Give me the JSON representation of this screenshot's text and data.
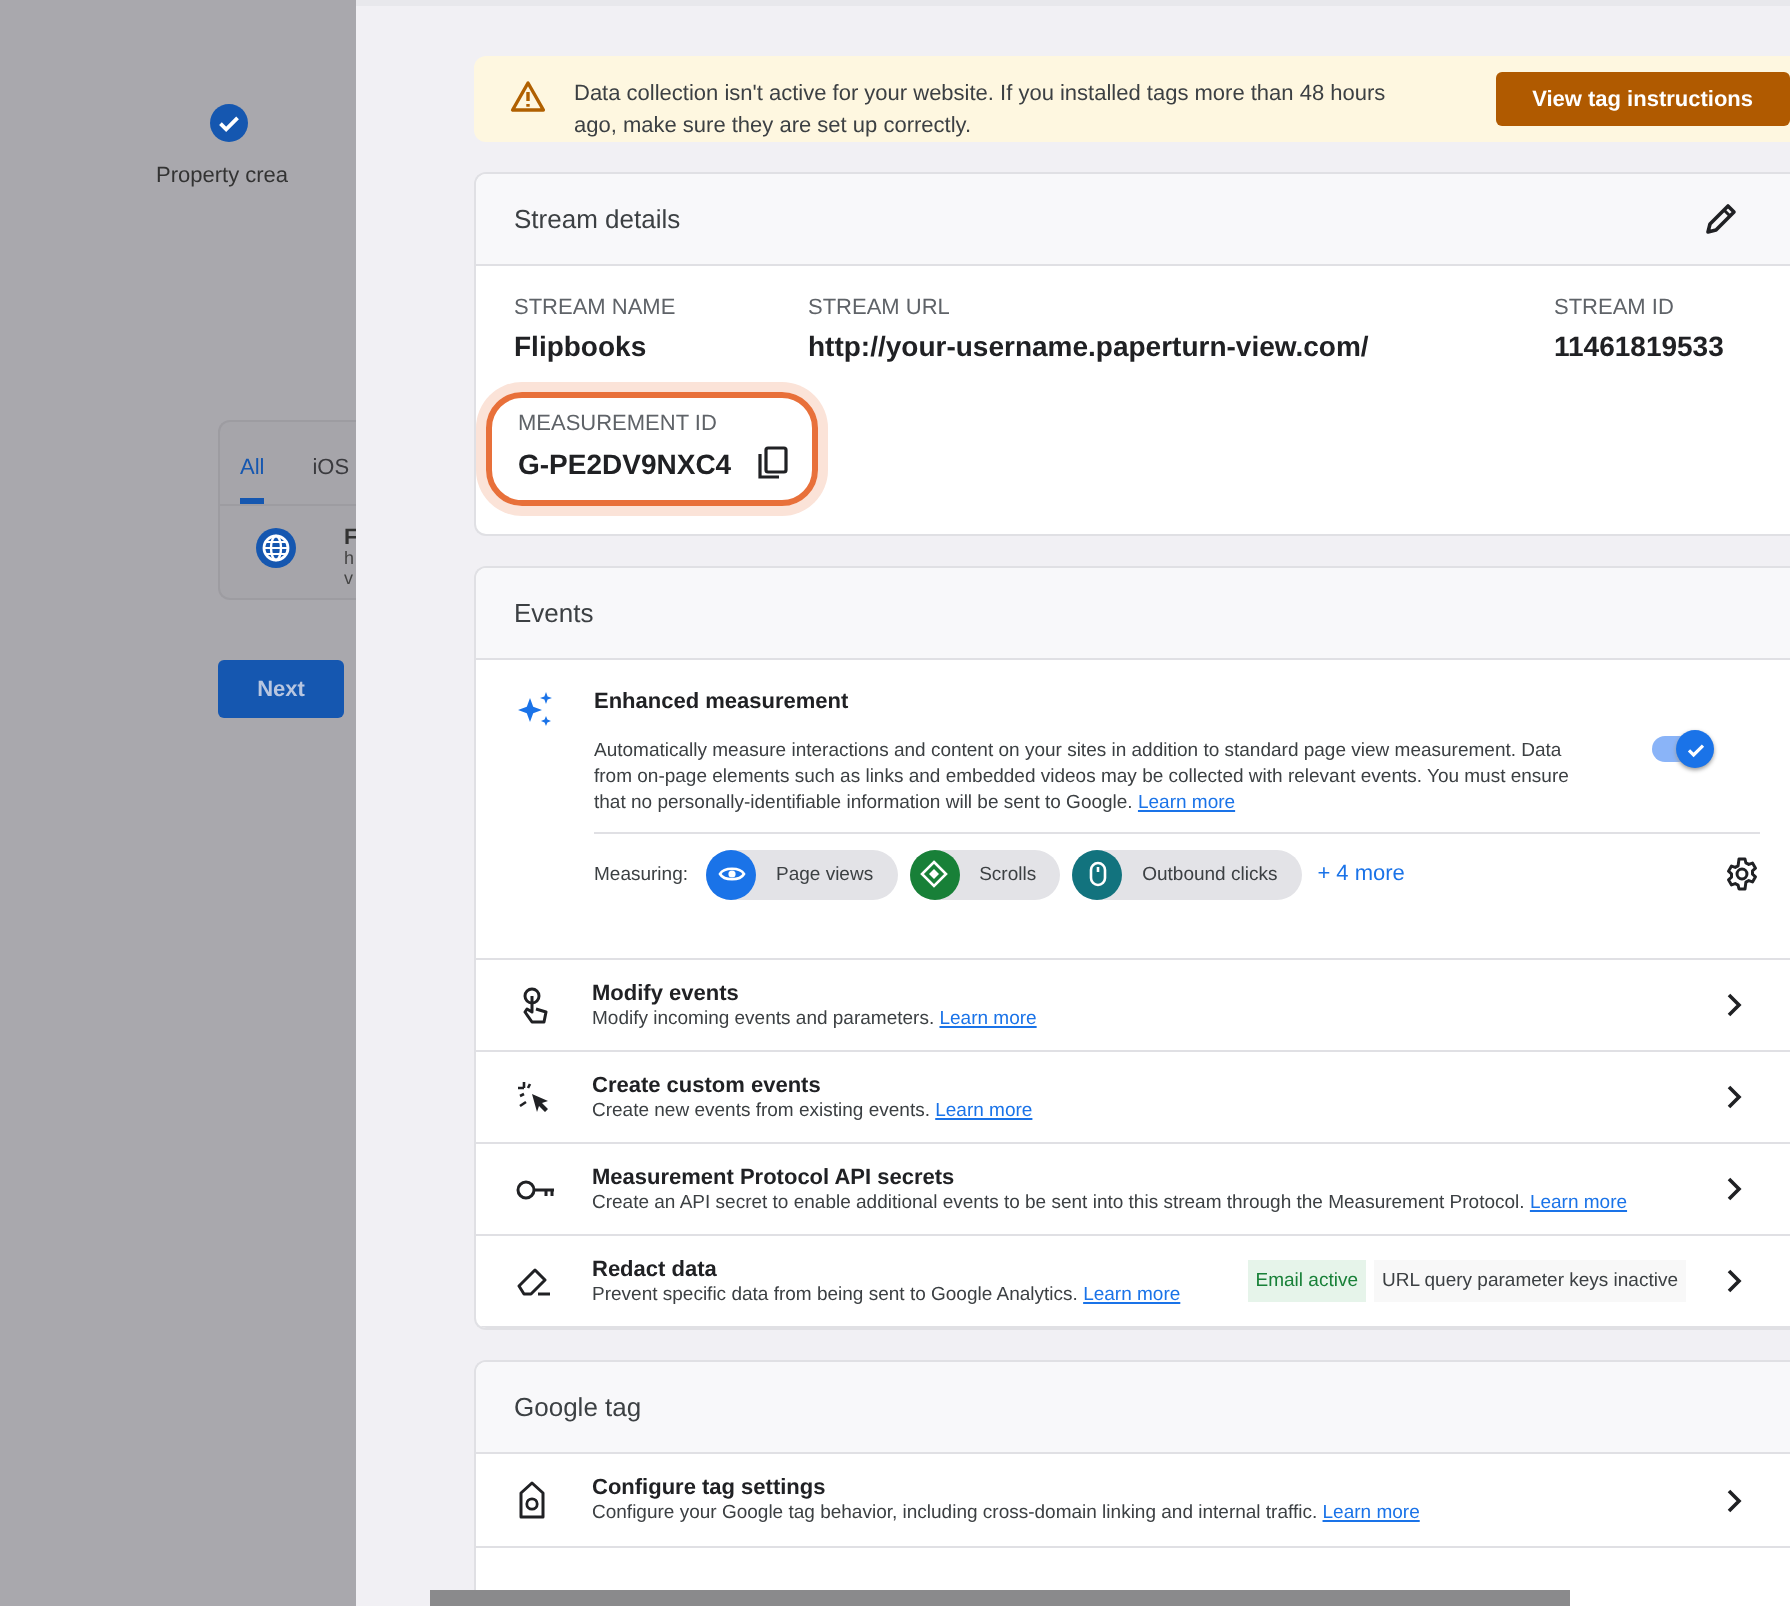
{
  "background_page": {
    "step_label": "Property crea",
    "step_done": true,
    "tabs": [
      {
        "label": "All",
        "selected": true
      },
      {
        "label": "iOS",
        "selected": false
      }
    ],
    "stream_item_lines": [
      "F",
      "h",
      "v"
    ],
    "next_button": "Next"
  },
  "banner": {
    "message": "Data collection isn't active for your website. If you installed tags more than 48 hours ago, make sure they are set up correctly.",
    "button": "View tag instructions"
  },
  "stream_details": {
    "title": "Stream details",
    "fields": [
      {
        "label": "STREAM NAME",
        "value": "Flipbooks"
      },
      {
        "label": "STREAM URL",
        "value": "http://your-username.paperturn-view.com/"
      },
      {
        "label": "STREAM ID",
        "value": "11461819533"
      }
    ],
    "measurement_id": {
      "label": "MEASUREMENT ID",
      "value": "G-PE2DV9NXC4",
      "highlighted": true
    }
  },
  "events": {
    "title": "Events",
    "enhanced": {
      "title": "Enhanced measurement",
      "description": "Automatically measure interactions and content on your sites in addition to standard page view measurement. Data from on-page elements such as links and embedded videos may be collected with relevant events. You must ensure that no personally-identifiable information will be sent to Google.",
      "link": "Learn more",
      "on": true,
      "measuring_label": "Measuring:",
      "chips": [
        {
          "label": "Page views",
          "kind": "eye",
          "color": "#1a73e8"
        },
        {
          "label": "Scrolls",
          "kind": "scroll",
          "color": "#188038"
        },
        {
          "label": "Outbound clicks",
          "kind": "mouse",
          "color": "#12737e"
        }
      ],
      "more": "+ 4 more"
    },
    "rows": [
      {
        "kind": "touch",
        "title": "Modify events",
        "description": "Modify incoming events and parameters.",
        "link": "Learn more"
      },
      {
        "kind": "sparkle-cursor",
        "title": "Create custom events",
        "description": "Create new events from existing events.",
        "link": "Learn more"
      },
      {
        "kind": "key",
        "title": "Measurement Protocol API secrets",
        "description": "Create an API secret to enable additional events to be sent into this stream through the Measurement Protocol.",
        "link": "Learn more"
      },
      {
        "kind": "eraser",
        "title": "Redact data",
        "description": "Prevent specific data from being sent to Google Analytics.",
        "link": "Learn more",
        "badges": [
          {
            "label": "Email active",
            "kind": "active"
          },
          {
            "label": "URL query parameter keys inactive",
            "kind": "inactive"
          }
        ]
      }
    ]
  },
  "google_tag": {
    "title": "Google tag",
    "rows": [
      {
        "kind": "tag",
        "title": "Configure tag settings",
        "description": "Configure your Google tag behavior, including cross-domain linking and internal traffic.",
        "link": "Learn more"
      }
    ]
  }
}
